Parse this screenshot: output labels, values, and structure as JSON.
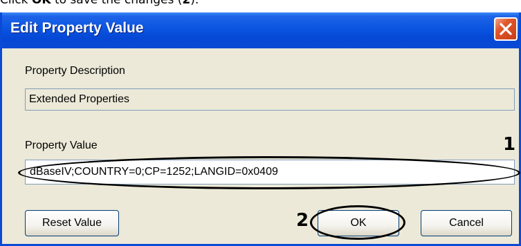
{
  "caption": {
    "prefix": "Click ",
    "bold": "OK",
    "middle": " to save the changes (",
    "bold2": "2",
    "suffix": ")."
  },
  "dialog": {
    "title": "Edit Property Value",
    "property_description_label": "Property Description",
    "property_description_value": "Extended Properties",
    "property_value_label": "Property Value",
    "property_value": "dBaseIV;COUNTRY=0;CP=1252;LANGID=0x0409",
    "reset_button": "Reset Value",
    "ok_button": "OK",
    "cancel_button": "Cancel"
  },
  "annotations": {
    "marker_1": "1",
    "marker_2": "2"
  },
  "colors": {
    "titlebar": "#0a4ad4",
    "dialog_bg": "#ece9d8",
    "close_button": "#e0582c"
  }
}
